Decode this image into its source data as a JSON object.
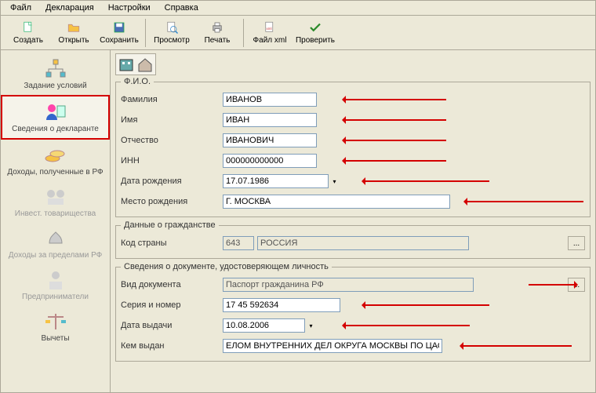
{
  "menubar": {
    "file": "Файл",
    "declaration": "Декларация",
    "settings": "Настройки",
    "help": "Справка"
  },
  "toolbar": {
    "create": "Создать",
    "open": "Открыть",
    "save": "Сохранить",
    "preview": "Просмотр",
    "print": "Печать",
    "file_xml": "Файл xml",
    "check": "Проверить"
  },
  "sidebar": {
    "items": [
      {
        "label": "Задание условий"
      },
      {
        "label": "Сведения о декларанте"
      },
      {
        "label": "Доходы, полученные в РФ"
      },
      {
        "label": "Инвест. товарищества"
      },
      {
        "label": "Доходы за пределами РФ"
      },
      {
        "label": "Предприниматели"
      },
      {
        "label": "Вычеты"
      }
    ]
  },
  "groups": {
    "fio": "Ф.И.О.",
    "citizenship": "Данные о гражданстве",
    "document": "Сведения о документе, удостоверяющем личность"
  },
  "labels": {
    "surname": "Фамилия",
    "name": "Имя",
    "patronymic": "Отчество",
    "inn": "ИНН",
    "birth_date": "Дата рождения",
    "birth_place": "Место рождения",
    "country_code": "Код страны",
    "doc_type": "Вид документа",
    "series_number": "Серия и номер",
    "issue_date": "Дата выдачи",
    "issued_by": "Кем выдан"
  },
  "values": {
    "surname": "ИВАНОВ",
    "name": "ИВАН",
    "patronymic": "ИВАНОВИЧ",
    "inn": "000000000000",
    "birth_date": "17.07.1986",
    "birth_place": "Г. МОСКВА",
    "country_code": "643",
    "country_name": "РОССИЯ",
    "doc_type": "Паспорт гражданина РФ",
    "series_number": "17 45 592634",
    "issue_date": "10.08.2006",
    "issued_by": "ЕЛОМ ВНУТРЕННИХ ДЕЛ ОКРУГА МОСКВЫ ПО ЦАО"
  },
  "buttons": {
    "lookup": "..."
  }
}
